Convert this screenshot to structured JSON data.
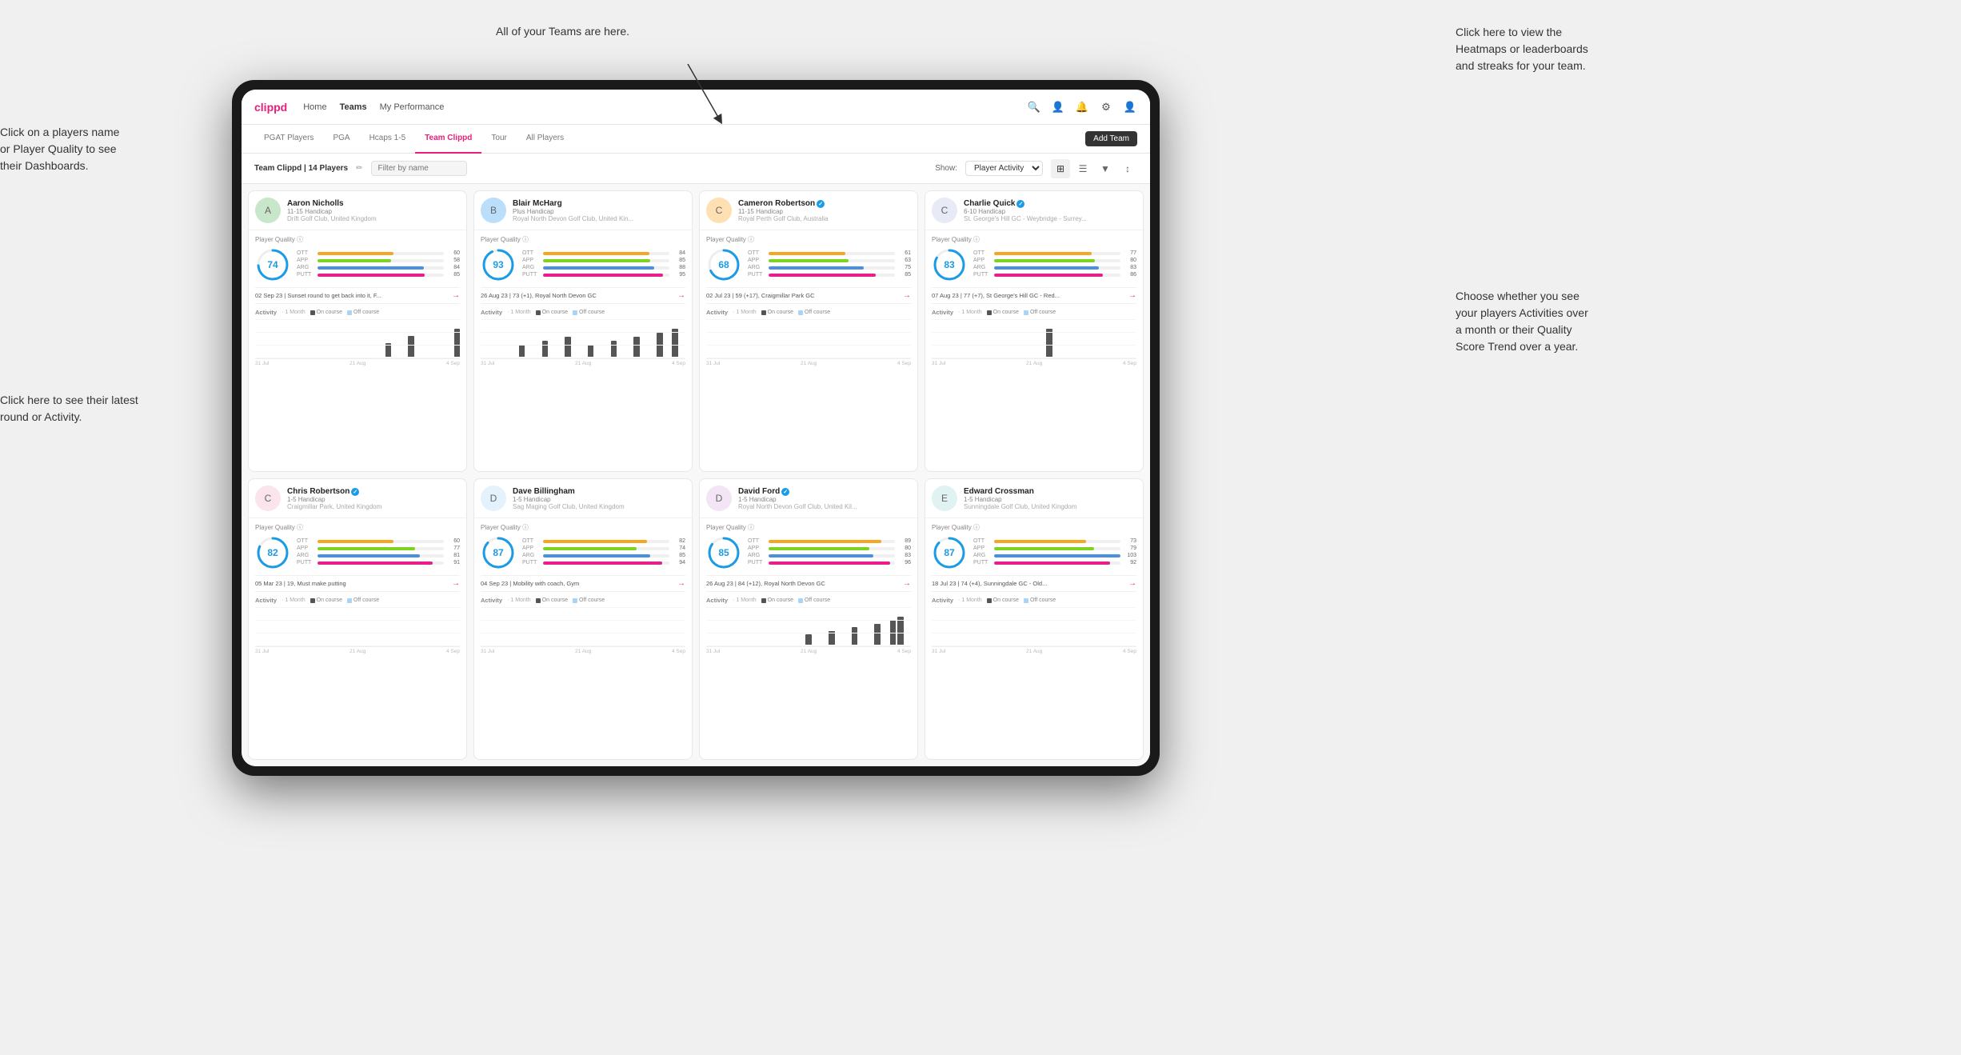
{
  "annotations": {
    "teams_tooltip": "All of your Teams are here.",
    "heatmaps_tooltip": "Click here to view the\nHeatmaps or leaderboards\nand streaks for your team.",
    "players_name_tooltip": "Click on a players name\nor Player Quality to see\ntheir Dashboards.",
    "latest_round_tooltip": "Click here to see their latest\nround or Activity.",
    "activity_tooltip": "Choose whether you see\nyour players Activities over\na month or their Quality\nScore Trend over a year."
  },
  "nav": {
    "logo": "clippd",
    "links": [
      "Home",
      "Teams",
      "My Performance"
    ],
    "active_link": "Teams"
  },
  "sub_nav": {
    "links": [
      "PGAT Players",
      "PGA",
      "Hcaps 1-5",
      "Team Clippd",
      "Tour",
      "All Players"
    ],
    "active_link": "Team Clippd",
    "add_team_label": "Add Team"
  },
  "toolbar": {
    "team_label": "Team Clippd | 14 Players",
    "search_placeholder": "Filter by name",
    "show_label": "Show:",
    "show_option": "Player Activity"
  },
  "players": [
    {
      "name": "Aaron Nicholls",
      "handicap": "11-15 Handicap",
      "club": "Drift Golf Club, United Kingdom",
      "quality": 74,
      "stats": {
        "OTT": 60,
        "APP": 58,
        "ARG": 84,
        "PUTT": 85
      },
      "recent_round": "02 Sep 23 | Sunset round to get back into it, F...",
      "chart_bars": [
        0,
        0,
        0,
        0,
        0,
        0,
        0,
        0,
        0,
        0,
        0,
        0,
        0,
        0,
        0,
        0,
        0,
        2,
        0,
        0,
        3,
        0,
        0,
        0,
        0,
        0,
        4
      ],
      "chart_labels": [
        "31 Jul",
        "21 Aug",
        "4 Sep"
      ]
    },
    {
      "name": "Blair McHarg",
      "handicap": "Plus Handicap",
      "club": "Royal North Devon Golf Club, United Kin...",
      "quality": 93,
      "stats": {
        "OTT": 84,
        "APP": 85,
        "ARG": 88,
        "PUTT": 95
      },
      "recent_round": "26 Aug 23 | 73 (+1), Royal North Devon GC",
      "chart_bars": [
        0,
        0,
        0,
        0,
        0,
        3,
        0,
        0,
        4,
        0,
        0,
        5,
        0,
        0,
        3,
        0,
        0,
        4,
        0,
        0,
        5,
        0,
        0,
        6,
        0,
        7,
        0
      ],
      "chart_labels": [
        "31 Jul",
        "21 Aug",
        "4 Sep"
      ]
    },
    {
      "name": "Cameron Robertson",
      "handicap": "11-15 Handicap",
      "club": "Royal Perth Golf Club, Australia",
      "quality": 68,
      "stats": {
        "OTT": 61,
        "APP": 63,
        "ARG": 75,
        "PUTT": 85
      },
      "recent_round": "02 Jul 23 | 59 (+17), Craigmillar Park GC",
      "chart_bars": [
        0,
        0,
        0,
        0,
        0,
        0,
        0,
        0,
        0,
        0,
        0,
        0,
        0,
        0,
        0,
        0,
        0,
        0,
        0,
        0,
        0,
        0,
        0,
        0,
        0,
        0,
        0
      ],
      "chart_labels": [
        "31 Jul",
        "21 Aug",
        "4 Sep"
      ]
    },
    {
      "name": "Charlie Quick",
      "handicap": "6-10 Handicap",
      "club": "St. George's Hill GC - Weybridge - Surrey...",
      "quality": 83,
      "stats": {
        "OTT": 77,
        "APP": 80,
        "ARG": 83,
        "PUTT": 86
      },
      "recent_round": "07 Aug 23 | 77 (+7), St George's Hill GC - Red...",
      "chart_bars": [
        0,
        0,
        0,
        0,
        0,
        0,
        0,
        0,
        0,
        0,
        0,
        0,
        0,
        0,
        0,
        4,
        0,
        0,
        0,
        0,
        0,
        0,
        0,
        0,
        0,
        0,
        0
      ],
      "chart_labels": [
        "31 Jul",
        "21 Aug",
        "4 Sep"
      ]
    },
    {
      "name": "Chris Robertson",
      "handicap": "1-5 Handicap",
      "club": "Craigmillar Park, United Kingdom",
      "quality": 82,
      "stats": {
        "OTT": 60,
        "APP": 77,
        "ARG": 81,
        "PUTT": 91
      },
      "recent_round": "05 Mar 23 | 19, Must make putting",
      "chart_bars": [
        0,
        0,
        0,
        0,
        0,
        0,
        0,
        0,
        0,
        0,
        0,
        0,
        0,
        0,
        0,
        0,
        0,
        0,
        0,
        0,
        0,
        0,
        0,
        0,
        0,
        0,
        0
      ],
      "chart_labels": [
        "31 Jul",
        "21 Aug",
        "4 Sep"
      ]
    },
    {
      "name": "Dave Billingham",
      "handicap": "1-5 Handicap",
      "club": "Sag Maging Golf Club, United Kingdom",
      "quality": 87,
      "stats": {
        "OTT": 82,
        "APP": 74,
        "ARG": 85,
        "PUTT": 94
      },
      "recent_round": "04 Sep 23 | Mobility with coach, Gym",
      "chart_bars": [
        0,
        0,
        0,
        0,
        0,
        0,
        0,
        0,
        0,
        0,
        0,
        0,
        0,
        0,
        0,
        0,
        0,
        0,
        0,
        0,
        0,
        0,
        0,
        0,
        0,
        0,
        0
      ],
      "chart_labels": [
        "31 Jul",
        "21 Aug",
        "4 Sep"
      ]
    },
    {
      "name": "David Ford",
      "handicap": "1-5 Handicap",
      "club": "Royal North Devon Golf Club, United Kil...",
      "quality": 85,
      "stats": {
        "OTT": 89,
        "APP": 80,
        "ARG": 83,
        "PUTT": 96
      },
      "recent_round": "26 Aug 23 | 84 (+12), Royal North Devon GC",
      "chart_bars": [
        0,
        0,
        0,
        0,
        0,
        0,
        0,
        0,
        0,
        0,
        0,
        0,
        0,
        3,
        0,
        0,
        4,
        0,
        0,
        5,
        0,
        0,
        6,
        0,
        7,
        8,
        0
      ],
      "chart_labels": [
        "31 Jul",
        "21 Aug",
        "4 Sep"
      ]
    },
    {
      "name": "Edward Crossman",
      "handicap": "1-5 Handicap",
      "club": "Sunningdale Golf Club, United Kingdom",
      "quality": 87,
      "stats": {
        "OTT": 73,
        "APP": 79,
        "ARG": 103,
        "PUTT": 92
      },
      "recent_round": "18 Jul 23 | 74 (+4), Sunningdale GC - Old...",
      "chart_bars": [
        0,
        0,
        0,
        0,
        0,
        0,
        0,
        0,
        0,
        0,
        0,
        0,
        0,
        0,
        0,
        0,
        0,
        0,
        0,
        0,
        0,
        0,
        0,
        0,
        0,
        0,
        0
      ],
      "chart_labels": [
        "31 Jul",
        "21 Aug",
        "4 Sep"
      ]
    }
  ],
  "activity_legend": {
    "label": "Activity",
    "period": "1 Month",
    "on_course": "On course",
    "off_course": "Off course",
    "on_color": "#555",
    "off_color": "#aad4f5"
  }
}
